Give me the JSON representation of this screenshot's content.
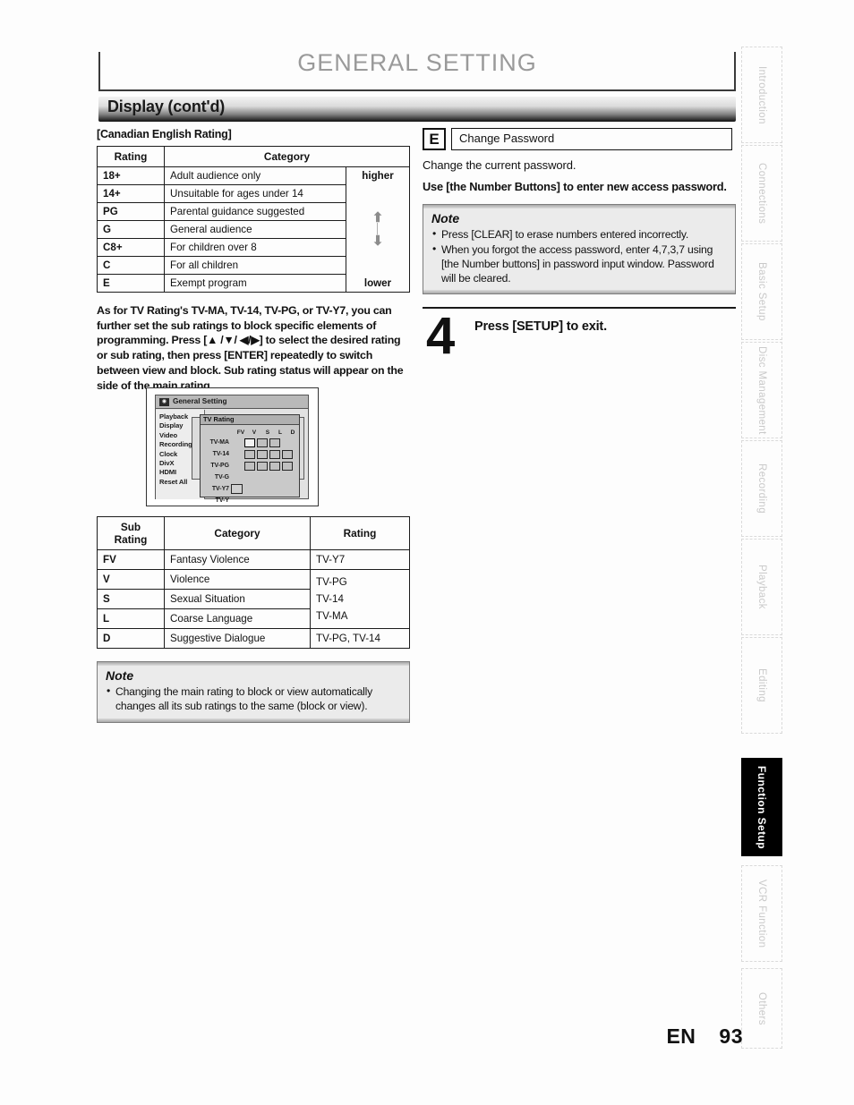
{
  "page": {
    "header_title": "GENERAL SETTING",
    "section_title": "Display (cont'd)",
    "footer_language": "EN",
    "footer_page_number": "93"
  },
  "left_column": {
    "subheading": "[Canadian English Rating]",
    "rating_table": {
      "headers": [
        "Rating",
        "Category"
      ],
      "scale_top_label": "higher",
      "scale_bottom_label": "lower",
      "rows": [
        {
          "rating": "18+",
          "category": "Adult audience only"
        },
        {
          "rating": "14+",
          "category": "Unsuitable for ages under 14"
        },
        {
          "rating": "PG",
          "category": "Parental guidance suggested"
        },
        {
          "rating": "G",
          "category": "General audience"
        },
        {
          "rating": "C8+",
          "category": "For children over 8"
        },
        {
          "rating": "C",
          "category": "For all children"
        },
        {
          "rating": "E",
          "category": "Exempt program"
        }
      ]
    },
    "paragraph": "As for TV Rating's TV-MA, TV-14, TV-PG, or TV-Y7, you can further set the sub ratings to block specific elements of programming. Press [▲ /▼/ ◀/▶] to select the desired rating or sub rating, then press [ENTER] repeatedly to switch between view and block. Sub rating status will appear on the side of the main rating.",
    "screenshot": {
      "window_title": "General Setting",
      "window_icon": "disc-icon",
      "menu_items": [
        "Playback",
        "Display",
        "Video",
        "Recording",
        "Clock",
        "DivX",
        "HDMI",
        "Reset All"
      ],
      "panel_title": "TV Rating",
      "column_headers": [
        "FV",
        "V",
        "S",
        "L",
        "D"
      ],
      "row_labels": [
        "TV-MA",
        "TV-14",
        "TV-PG",
        "TV-G",
        "TV-Y7",
        "TV-Y"
      ]
    },
    "sub_rating_table": {
      "headers": [
        "Sub Rating",
        "Category",
        "Rating"
      ],
      "rows": [
        {
          "code": "FV",
          "category": "Fantasy Violence",
          "rating": "TV-Y7"
        },
        {
          "code": "V",
          "category": "Violence",
          "rating": ""
        },
        {
          "code": "S",
          "category": "Sexual Situation",
          "rating": ""
        },
        {
          "code": "L",
          "category": "Coarse Language",
          "rating": ""
        },
        {
          "code": "D",
          "category": "Suggestive Dialogue",
          "rating": "TV-PG, TV-14"
        }
      ],
      "merged_rating_lines": [
        "TV-PG",
        "TV-14",
        "TV-MA"
      ]
    },
    "note": {
      "title": "Note",
      "items": [
        "Changing the main rating to block or view automatically changes all its sub ratings to the same (block or view)."
      ]
    }
  },
  "right_column": {
    "step_badge": "E",
    "step_field_label": "Change Password",
    "description": "Change the current password.",
    "instruction": "Use [the Number Buttons] to enter new access password.",
    "note": {
      "title": "Note",
      "items": [
        "Press [CLEAR] to erase numbers entered incorrectly.",
        "When you forgot the access password, enter 4,7,3,7 using [the Number buttons] in password input window. Password will be cleared."
      ]
    },
    "step4": {
      "number": "4",
      "text": "Press [SETUP] to exit."
    }
  },
  "side_tabs": [
    {
      "label": "Introduction",
      "active": false
    },
    {
      "label": "Connections",
      "active": false
    },
    {
      "label": "Basic Setup",
      "active": false
    },
    {
      "label": "Disc Management",
      "active": false
    },
    {
      "label": "Recording",
      "active": false
    },
    {
      "label": "Playback",
      "active": false
    },
    {
      "label": "Editing",
      "active": false
    },
    {
      "label": "Function Setup",
      "active": true
    },
    {
      "label": "VCR Function",
      "active": false
    },
    {
      "label": "Others",
      "active": false
    }
  ]
}
